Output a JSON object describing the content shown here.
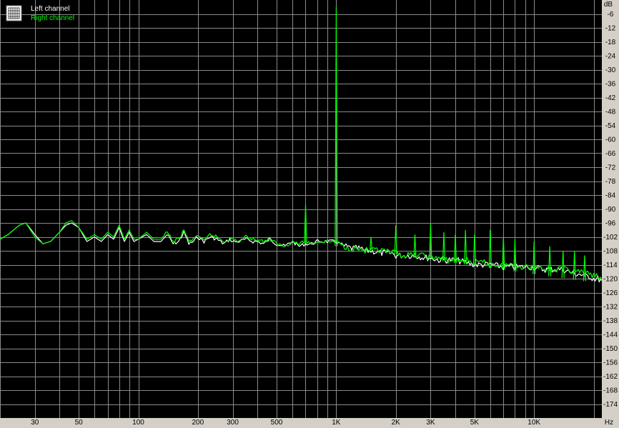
{
  "chart_data": {
    "type": "line",
    "x_scale": "log",
    "xlim": [
      20,
      22000
    ],
    "ylim": [
      -180,
      0
    ],
    "x_unit": "Hz",
    "y_unit": "dB",
    "x_ticks": [
      {
        "value": 30,
        "label": "30"
      },
      {
        "value": 50,
        "label": "50"
      },
      {
        "value": 100,
        "label": "100"
      },
      {
        "value": 200,
        "label": "200"
      },
      {
        "value": 300,
        "label": "300"
      },
      {
        "value": 500,
        "label": "500"
      },
      {
        "value": 1000,
        "label": "1K"
      },
      {
        "value": 2000,
        "label": "2K"
      },
      {
        "value": 3000,
        "label": "3K"
      },
      {
        "value": 5000,
        "label": "5K"
      },
      {
        "value": 10000,
        "label": "10K"
      }
    ],
    "y_ticks": [
      -6,
      -12,
      -18,
      -24,
      -30,
      -36,
      -42,
      -48,
      -54,
      -60,
      -66,
      -72,
      -78,
      -84,
      -90,
      -96,
      -102,
      -108,
      -114,
      -120,
      -126,
      -132,
      -138,
      -144,
      -150,
      -156,
      -162,
      -168,
      -174
    ],
    "grid": true,
    "legend_position": "top-left",
    "background": "#000000",
    "grid_color": "#8a8a8a",
    "series": [
      {
        "name": "Left channel",
        "color": "#ffffff",
        "x": [
          20,
          22,
          25,
          27,
          30,
          33,
          36,
          40,
          43,
          46,
          50,
          55,
          60,
          65,
          70,
          75,
          80,
          85,
          90,
          95,
          100,
          110,
          120,
          130,
          140,
          150,
          160,
          170,
          180,
          190,
          200,
          215,
          230,
          250,
          270,
          290,
          300,
          320,
          350,
          380,
          400,
          430,
          460,
          500,
          550,
          600,
          650,
          700,
          750,
          800,
          850,
          900,
          950,
          1000,
          1050,
          1100,
          1200,
          1300,
          1400,
          1500,
          1700,
          1900,
          2000,
          2200,
          2500,
          2800,
          3000,
          3300,
          3600,
          4000,
          4500,
          5000,
          5500,
          6000,
          7000,
          8000,
          9000,
          10000,
          11000,
          12000,
          13000,
          14000,
          15000,
          16000,
          17000,
          18000,
          19000,
          20000,
          21000,
          22000
        ],
        "y": [
          -103,
          -101,
          -97,
          -96,
          -101,
          -105,
          -104,
          -100,
          -97,
          -96,
          -98,
          -104,
          -102,
          -104,
          -101,
          -103,
          -98,
          -104,
          -100,
          -104,
          -103,
          -101,
          -104,
          -104,
          -101,
          -105,
          -104,
          -100,
          -105,
          -104,
          -102,
          -104,
          -102,
          -103,
          -105,
          -103,
          -104,
          -104,
          -103,
          -104,
          -104,
          -105,
          -103,
          -105,
          -106,
          -104,
          -106,
          -105,
          -105,
          -104,
          -104,
          -104,
          -104,
          -104,
          -105,
          -106,
          -107,
          -107,
          -108,
          -108,
          -109,
          -109,
          -110,
          -110,
          -110,
          -111,
          -111,
          -112,
          -112,
          -112,
          -113,
          -114,
          -114,
          -114,
          -115,
          -115,
          -115,
          -115,
          -116,
          -116,
          -116,
          -116,
          -117,
          -118,
          -118,
          -119,
          -119,
          -120,
          -120,
          -121
        ]
      },
      {
        "name": "Right channel",
        "color": "#00ff00",
        "x": [
          20,
          22,
          25,
          27,
          30,
          33,
          36,
          40,
          43,
          46,
          50,
          55,
          60,
          65,
          70,
          75,
          80,
          85,
          90,
          95,
          100,
          110,
          120,
          130,
          140,
          150,
          160,
          170,
          180,
          190,
          200,
          215,
          230,
          250,
          270,
          290,
          300,
          320,
          350,
          380,
          400,
          430,
          460,
          500,
          550,
          600,
          650,
          700,
          750,
          800,
          850,
          900,
          950,
          1000,
          1050,
          1100,
          1200,
          1300,
          1400,
          1500,
          1700,
          1900,
          2000,
          2200,
          2500,
          2800,
          3000,
          3300,
          3600,
          4000,
          4500,
          5000,
          5500,
          6000,
          7000,
          8000,
          9000,
          10000,
          11000,
          12000,
          13000,
          14000,
          15000,
          16000,
          17000,
          18000,
          19000,
          20000,
          21000,
          22000
        ],
        "y": [
          -103,
          -101,
          -97,
          -96,
          -102,
          -105,
          -104,
          -100,
          -96,
          -95,
          -98,
          -103,
          -101,
          -103,
          -100,
          -102,
          -97,
          -103,
          -99,
          -103,
          -103,
          -100,
          -103,
          -103,
          -100,
          -104,
          -103,
          -99,
          -104,
          -103,
          -101,
          -104,
          -101,
          -102,
          -104,
          -103,
          -103,
          -104,
          -102,
          -103,
          -103,
          -104,
          -103,
          -105,
          -106,
          -104,
          -105,
          -104,
          -105,
          -104,
          -104,
          -104,
          -104,
          -104,
          -105,
          -106,
          -107,
          -107,
          -108,
          -108,
          -108,
          -109,
          -109,
          -110,
          -110,
          -110,
          -111,
          -111,
          -112,
          -112,
          -112,
          -113,
          -113,
          -114,
          -114,
          -114,
          -115,
          -115,
          -115,
          -116,
          -116,
          -116,
          -116,
          -117,
          -117,
          -118,
          -118,
          -119,
          -119,
          -121
        ]
      }
    ],
    "peaks": [
      {
        "x": 1000,
        "y": -3
      },
      {
        "x": 700,
        "y": -88
      },
      {
        "x": 2000,
        "y": -97
      },
      {
        "x": 3000,
        "y": -96
      },
      {
        "x": 1500,
        "y": -102
      },
      {
        "x": 2500,
        "y": -101
      },
      {
        "x": 3500,
        "y": -100
      },
      {
        "x": 4000,
        "y": -101
      },
      {
        "x": 4500,
        "y": -99
      },
      {
        "x": 5000,
        "y": -101
      },
      {
        "x": 6000,
        "y": -99
      },
      {
        "x": 7000,
        "y": -102
      },
      {
        "x": 8000,
        "y": -103
      },
      {
        "x": 10000,
        "y": -104
      },
      {
        "x": 12000,
        "y": -106
      },
      {
        "x": 14000,
        "y": -108
      },
      {
        "x": 16000,
        "y": -108
      },
      {
        "x": 18000,
        "y": -110
      }
    ]
  }
}
